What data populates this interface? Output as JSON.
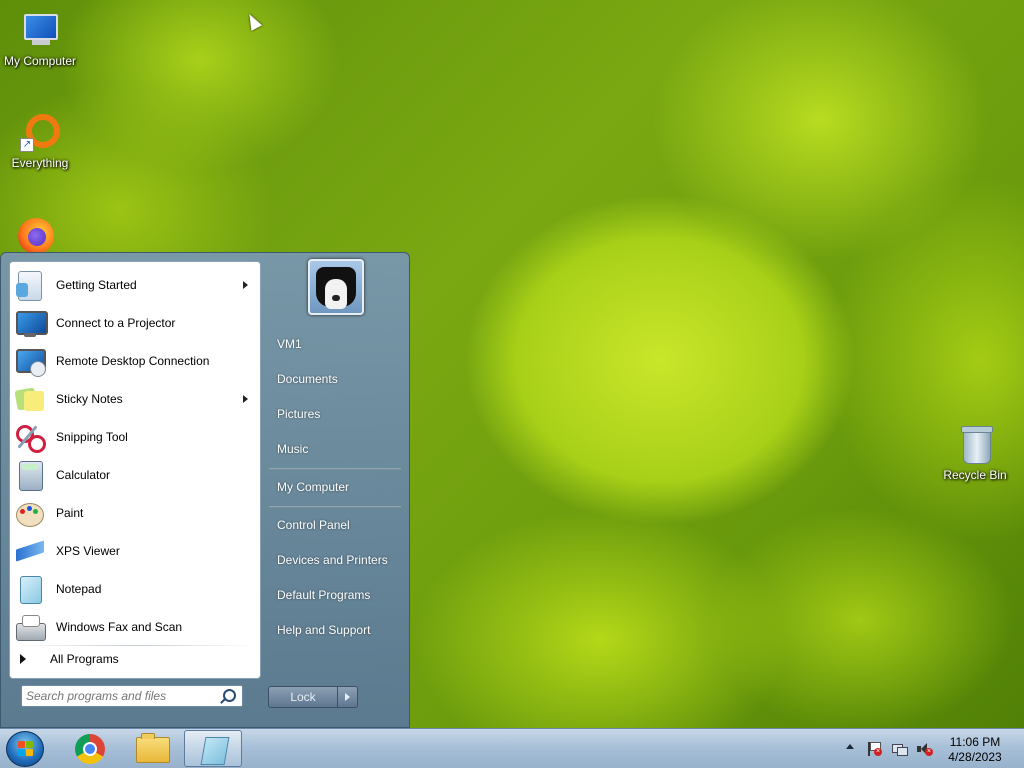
{
  "desktop": {
    "icons": [
      {
        "label": "My Computer"
      },
      {
        "label": "Everything"
      },
      {
        "label": "Recycle Bin"
      }
    ]
  },
  "start_menu": {
    "programs": [
      {
        "label": "Getting Started",
        "has_submenu": true,
        "icon": "getting-started-icon"
      },
      {
        "label": "Connect to a Projector",
        "has_submenu": false,
        "icon": "projector-icon"
      },
      {
        "label": "Remote Desktop Connection",
        "has_submenu": false,
        "icon": "remote-desktop-icon"
      },
      {
        "label": "Sticky Notes",
        "has_submenu": true,
        "icon": "sticky-notes-icon"
      },
      {
        "label": "Snipping Tool",
        "has_submenu": false,
        "icon": "scissors-icon"
      },
      {
        "label": "Calculator",
        "has_submenu": false,
        "icon": "calculator-icon"
      },
      {
        "label": "Paint",
        "has_submenu": false,
        "icon": "paint-palette-icon"
      },
      {
        "label": "XPS Viewer",
        "has_submenu": false,
        "icon": "xps-viewer-icon"
      },
      {
        "label": "Notepad",
        "has_submenu": false,
        "icon": "notepad-icon"
      },
      {
        "label": "Windows Fax and Scan",
        "has_submenu": false,
        "icon": "fax-icon"
      }
    ],
    "all_programs": "All Programs",
    "search": {
      "placeholder": "Search programs and files"
    },
    "right": {
      "user": "VM1",
      "documents": "Documents",
      "pictures": "Pictures",
      "music": "Music",
      "computer": "My Computer",
      "control_panel": "Control Panel",
      "devices": "Devices and Printers",
      "default_programs": "Default Programs",
      "help": "Help and Support"
    },
    "lock_label": "Lock"
  },
  "taskbar": {
    "time": "11:06 PM",
    "date": "4/28/2023"
  },
  "colors": {
    "taskbar": "#a8c0d8",
    "start_menu_right": "#6f8aa6",
    "wallpaper_green": "#a8d018"
  }
}
